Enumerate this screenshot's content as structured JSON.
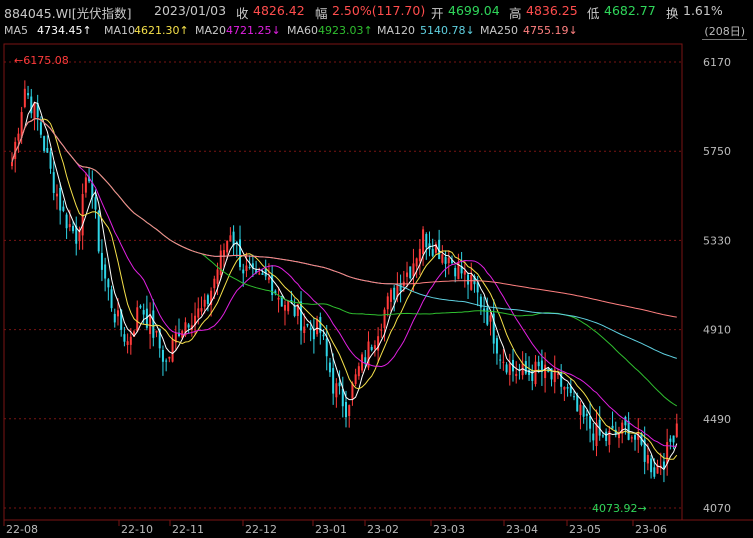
{
  "header": {
    "code": "884045.WI[光伏指数]",
    "date": "2023/01/03",
    "close_label": "收",
    "close": "4826.42",
    "change_label": "幅",
    "change": "2.50%(117.70)",
    "open_label": "开",
    "open": "4699.04",
    "high_label": "高",
    "high": "4836.25",
    "low_label": "低",
    "low": "4682.77",
    "turnover_label": "换",
    "turnover": "1.61%"
  },
  "ma_legend": [
    {
      "label": "MA5",
      "value": "4734.45↑",
      "color": "#ffffff"
    },
    {
      "label": "MA10",
      "value": "4621.30↑",
      "color": "#f5e04a"
    },
    {
      "label": "MA20",
      "value": "4721.25↓",
      "color": "#e020e0"
    },
    {
      "label": "MA60",
      "value": "4923.03↑",
      "color": "#2fbf2f"
    },
    {
      "label": "MA120",
      "value": "5140.78↓",
      "color": "#5fd0e0"
    },
    {
      "label": "MA250",
      "value": "4755.19↓",
      "color": "#ff8080"
    }
  ],
  "period_label": "(208日)",
  "colors": {
    "up": "#ff3b3b",
    "down": "#2fd6e8",
    "ma5": "#ffffff",
    "ma10": "#f5e04a",
    "ma20": "#e020e0",
    "ma60": "#2fbf2f",
    "ma120": "#5fd0e0",
    "ma250": "#ff8080",
    "grid": "#7a1414"
  },
  "chart_data": {
    "type": "candlestick",
    "y_ticks": [
      6170,
      5750,
      5330,
      4910,
      4490,
      4070
    ],
    "ylim": [
      4040,
      6230
    ],
    "x_labels": [
      "22-08",
      "22-10",
      "22-11",
      "22-12",
      "23-01",
      "23-02",
      "23-03",
      "23-04",
      "23-05",
      "23-06"
    ],
    "annotations": [
      {
        "text": "6175.08",
        "type": "max"
      },
      {
        "text": "4073.92",
        "type": "min"
      }
    ],
    "anchors": [
      [
        0,
        5700
      ],
      [
        4,
        6050
      ],
      [
        8,
        5900
      ],
      [
        12,
        5650
      ],
      [
        16,
        5450
      ],
      [
        20,
        5350
      ],
      [
        24,
        5650
      ],
      [
        28,
        5200
      ],
      [
        32,
        4980
      ],
      [
        36,
        4850
      ],
      [
        40,
        5030
      ],
      [
        44,
        4900
      ],
      [
        48,
        4750
      ],
      [
        52,
        4920
      ],
      [
        56,
        4980
      ],
      [
        60,
        5000
      ],
      [
        64,
        5200
      ],
      [
        68,
        5380
      ],
      [
        72,
        5200
      ],
      [
        76,
        5130
      ],
      [
        80,
        5150
      ],
      [
        84,
        5050
      ],
      [
        88,
        5000
      ],
      [
        92,
        4920
      ],
      [
        96,
        4900
      ],
      [
        100,
        4650
      ],
      [
        104,
        4550
      ],
      [
        108,
        4720
      ],
      [
        112,
        4850
      ],
      [
        116,
        5000
      ],
      [
        120,
        5120
      ],
      [
        124,
        5200
      ],
      [
        128,
        5350
      ],
      [
        132,
        5300
      ],
      [
        136,
        5250
      ],
      [
        140,
        5180
      ],
      [
        144,
        5100
      ],
      [
        148,
        4980
      ],
      [
        152,
        4800
      ],
      [
        156,
        4720
      ],
      [
        160,
        4700
      ],
      [
        164,
        4720
      ],
      [
        168,
        4680
      ],
      [
        172,
        4640
      ],
      [
        176,
        4520
      ],
      [
        180,
        4450
      ],
      [
        184,
        4390
      ],
      [
        188,
        4420
      ],
      [
        192,
        4440
      ],
      [
        196,
        4350
      ],
      [
        200,
        4250
      ],
      [
        204,
        4330
      ],
      [
        207,
        4480
      ]
    ]
  }
}
